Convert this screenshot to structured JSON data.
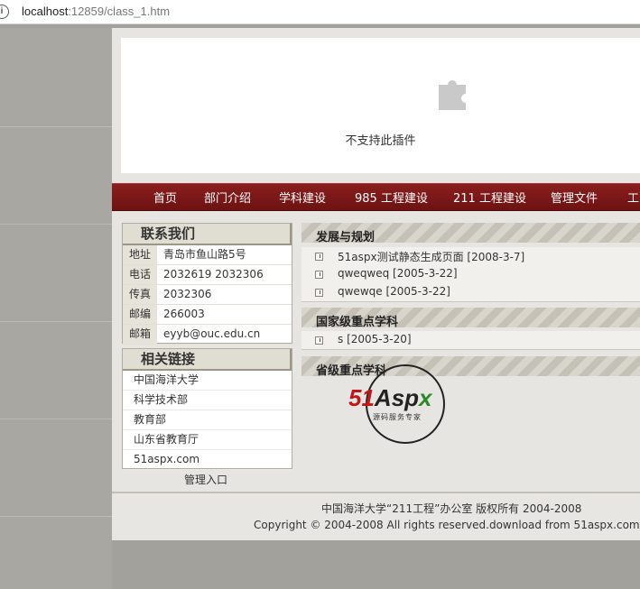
{
  "browser": {
    "url_host": "localhost",
    "url_rest": ":12859/class_1.htm",
    "info_icon": "info-icon"
  },
  "plugin": {
    "icon": "puzzle-icon",
    "message": "不支持此插件"
  },
  "nav": {
    "items": [
      "首页",
      "部门介绍",
      "学科建设",
      "985 工程建设",
      "211 工程建设",
      "管理文件",
      "工"
    ]
  },
  "contact": {
    "title": "联系我们",
    "rows": [
      {
        "label": "地址",
        "value": "青岛市鱼山路5号"
      },
      {
        "label": "电话",
        "value": "2032619  2032306"
      },
      {
        "label": "传真",
        "value": "2032306"
      },
      {
        "label": "邮编",
        "value": "266003"
      },
      {
        "label": "邮箱",
        "value": "eyyb@ouc.edu.cn"
      }
    ]
  },
  "links": {
    "title": "相关链接",
    "items": [
      "中国海洋大学",
      "科学技术部",
      "教育部",
      "山东省教育厅",
      "51aspx.com"
    ]
  },
  "admin_link": "管理入口",
  "sections": [
    {
      "title": "发展与规划",
      "items": [
        "51aspx测试静态生成页面 [2008-3-7]",
        "qweqweq [2005-3-22]",
        "qwewqe [2005-3-22]"
      ]
    },
    {
      "title": "国家级重点学科",
      "items": [
        "s [2005-3-20]"
      ]
    },
    {
      "title": "省级重点学科",
      "items": []
    }
  ],
  "logo": {
    "num": "51",
    "mid": "Asp",
    "x": "x",
    "sub": "源码服务专家"
  },
  "footer": {
    "line1": "中国海洋大学“211工程”办公室 版权所有 2004-2008",
    "line2": "Copyright © 2004-2008 All rights reserved.download from 51aspx.com"
  },
  "colors": {
    "nav_bg": "#7a1616",
    "page_bg": "#e6e5e1",
    "side_bg": "#a8a7a2"
  }
}
